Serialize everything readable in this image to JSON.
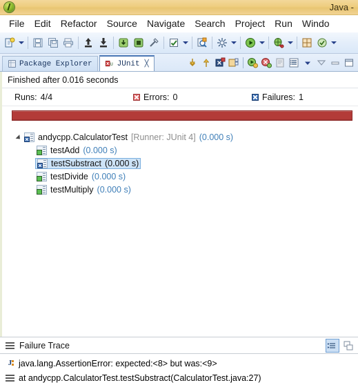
{
  "window": {
    "title": "Java -",
    "app_icon": "eclipse-icon"
  },
  "menubar": {
    "items": [
      {
        "label": "File"
      },
      {
        "label": "Edit"
      },
      {
        "label": "Refactor"
      },
      {
        "label": "Source"
      },
      {
        "label": "Navigate"
      },
      {
        "label": "Search"
      },
      {
        "label": "Project"
      },
      {
        "label": "Run"
      },
      {
        "label": "Windo"
      }
    ]
  },
  "toolbar": {
    "buttons": [
      {
        "name": "new-wizard-icon",
        "has_dropdown": true
      },
      {
        "name": "save-icon",
        "has_dropdown": false
      },
      {
        "name": "save-all-icon",
        "has_dropdown": false
      },
      {
        "name": "print-icon",
        "has_dropdown": false
      },
      {
        "name": "export-icon",
        "has_dropdown": false
      },
      {
        "name": "import-icon",
        "has_dropdown": false
      },
      {
        "name": "build-all-icon",
        "has_dropdown": false
      },
      {
        "name": "terminate-icon",
        "has_dropdown": false
      },
      {
        "name": "link-break-icon",
        "has_dropdown": false
      },
      {
        "name": "check-task-icon",
        "has_dropdown": true
      },
      {
        "name": "search-icon",
        "has_dropdown": false
      },
      {
        "name": "external-tools-icon",
        "has_dropdown": true
      },
      {
        "name": "run-icon",
        "has_dropdown": true
      },
      {
        "name": "debug-icon",
        "has_dropdown": true
      },
      {
        "name": "new-java-package-icon",
        "has_dropdown": false
      },
      {
        "name": "new-java-class-icon",
        "has_dropdown": true
      }
    ]
  },
  "tabs": [
    {
      "label": "Package Explorer",
      "icon": "package-explorer-icon",
      "active": false,
      "closable": false
    },
    {
      "label": "JUnit",
      "icon": "junit-icon",
      "active": true,
      "closable": true,
      "close_glyph": "╳"
    }
  ],
  "view_tools": [
    {
      "name": "next-failure-icon"
    },
    {
      "name": "previous-failure-icon"
    },
    {
      "name": "show-failures-only-icon"
    },
    {
      "name": "show-tests-in-hierarchy-icon"
    },
    {
      "name": "rerun-test-icon"
    },
    {
      "name": "rerun-test-failures-icon"
    },
    {
      "name": "history-icon"
    },
    {
      "name": "view-menu-list-icon"
    },
    {
      "name": "view-menu-dropdown-icon"
    },
    {
      "name": "pin-icon"
    },
    {
      "name": "minimize-icon"
    },
    {
      "name": "maximize-icon"
    }
  ],
  "junit": {
    "status_line": "Finished after 0.016 seconds",
    "counters": {
      "runs_label": "Runs:",
      "runs_value": "4/4",
      "errors_label": "Errors:",
      "errors_value": "0",
      "failures_label": "Failures:",
      "failures_value": "1"
    },
    "progress": {
      "percent": 100,
      "color": "#b33b38",
      "state": "failed"
    },
    "tree": {
      "root": {
        "name": "andycpp.CalculatorTest",
        "runner": "[Runner: JUnit 4]",
        "time": "(0.000 s)",
        "expanded": true,
        "status": "failed"
      },
      "children": [
        {
          "name": "testAdd",
          "time": "(0.000 s)",
          "status": "ok",
          "selected": false
        },
        {
          "name": "testSubstract",
          "time": "(0.000 s)",
          "status": "failed",
          "selected": true
        },
        {
          "name": "testDivide",
          "time": "(0.000 s)",
          "status": "ok",
          "selected": false
        },
        {
          "name": "testMultiply",
          "time": "(0.000 s)",
          "status": "ok",
          "selected": false
        }
      ]
    },
    "failure_trace": {
      "title": "Failure Trace",
      "tools": [
        {
          "name": "filter-stack-trace-icon",
          "pressed": true
        },
        {
          "name": "maximize-trace-icon",
          "pressed": false
        }
      ],
      "entries": [
        {
          "icon": "exception-icon",
          "text": "java.lang.AssertionError: expected:<8> but was:<9>"
        },
        {
          "icon": "stack-frame-icon",
          "text": "at andycpp.CalculatorTest.testSubstract(CalculatorTest.java:27)"
        }
      ]
    }
  }
}
